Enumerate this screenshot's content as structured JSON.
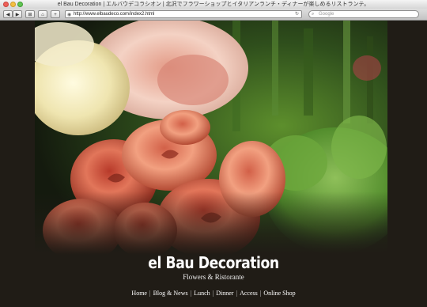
{
  "window": {
    "title": "el Bau Decoration | エルバウデコラシオン | 北沢でフラワーショップとイタリアンランチ・ディナーが楽しめるリストランテ。"
  },
  "toolbar": {
    "back_icon": "back-arrow-icon",
    "forward_icon": "forward-arrow-icon",
    "back_label": "◀",
    "forward_label": "▶",
    "view_label": "⊞",
    "home_label": "⌂",
    "add_label": "+",
    "url": "http://www.elbaudeco.com/index2.html",
    "search_placeholder": "Google"
  },
  "site": {
    "title": "el Bau Decoration",
    "subtitle": "Flowers & Ristorante",
    "nav": [
      "Home",
      "Blog & News",
      "Lunch",
      "Dinner",
      "Access",
      "Online Shop"
    ],
    "separator": "|"
  },
  "colors": {
    "page_bg": "#201c16",
    "text": "#ffffff",
    "rose": "#d9654a",
    "greenery": "#4a8a2a"
  }
}
